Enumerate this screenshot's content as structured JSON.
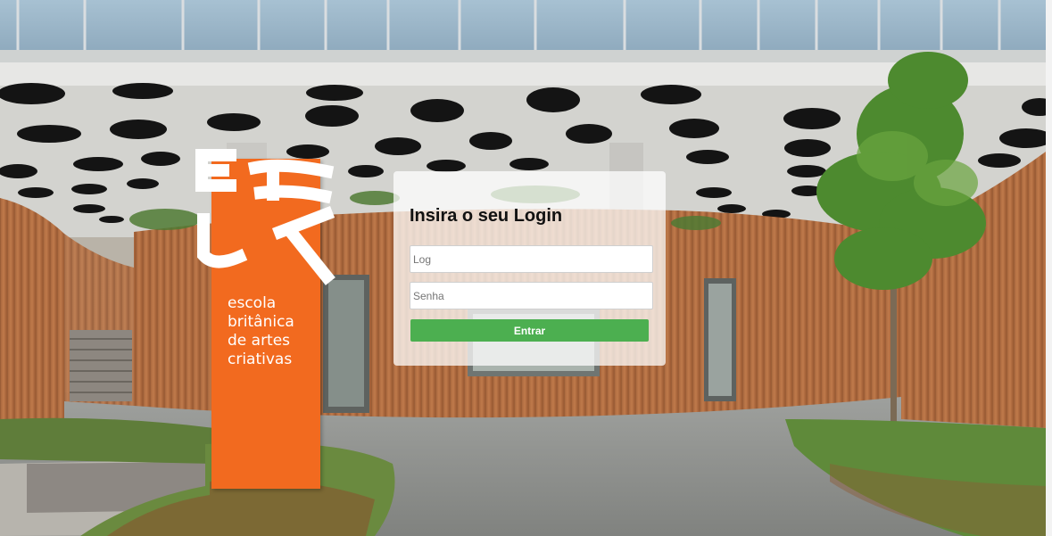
{
  "login": {
    "title": "Insira o seu Login",
    "login_placeholder": "Log",
    "login_value": "",
    "password_placeholder": "Senha",
    "password_value": "",
    "submit_label": "Entrar"
  },
  "sign": {
    "lines": [
      "escola",
      "britânica",
      "de artes",
      "criativas"
    ],
    "logo_text": "EBAC"
  },
  "colors": {
    "accent_green": "#4caf50",
    "sign_orange": "#f26a1f"
  }
}
